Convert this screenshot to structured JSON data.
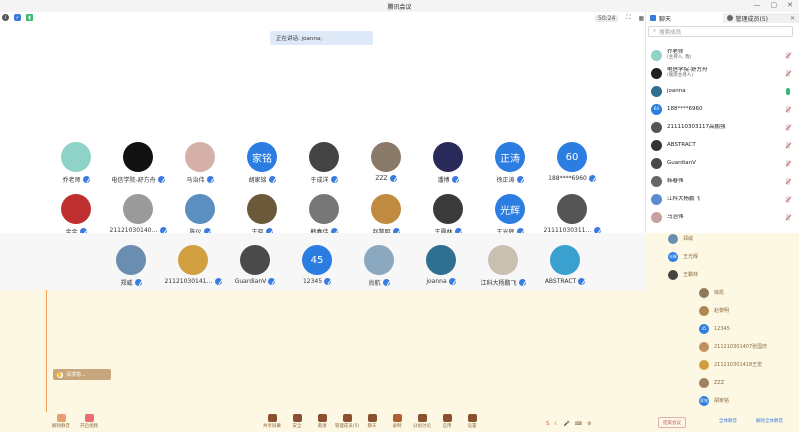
{
  "window": {
    "title": "腾讯会议",
    "controls": [
      "—",
      "▢",
      "✕"
    ]
  },
  "topbar": {
    "timer": "50:24",
    "speaking_label": "正在讲话: joanna;"
  },
  "panel": {
    "tabs": [
      {
        "label": "聊天",
        "icon": "chat-icon"
      },
      {
        "label": "管理成员(5)",
        "icon": "members-icon"
      }
    ],
    "search_placeholder": "搜索成员",
    "members": [
      {
        "name": "乔老师",
        "sub": "(主持人, 我)",
        "color": "#8fd3c8",
        "mic": "muted"
      },
      {
        "name": "电信学院-舒方舟",
        "sub": "(联席主持人)",
        "color": "#222222",
        "mic": "muted"
      },
      {
        "name": "joanna",
        "sub": "",
        "color": "#2f6f8f",
        "mic": "on"
      },
      {
        "name": "188****6960",
        "sub": "",
        "color": "#2b7de1",
        "avatar_text": "60",
        "mic": "muted"
      },
      {
        "name": "211110303117高鹏强",
        "sub": "",
        "color": "#555555",
        "mic": "muted"
      },
      {
        "name": "ABSTRACT",
        "sub": "",
        "color": "#333333",
        "mic": "muted"
      },
      {
        "name": "GuardianV",
        "sub": "",
        "color": "#4a4a4a",
        "mic": "muted"
      },
      {
        "name": "韩春伟",
        "sub": "",
        "color": "#666666",
        "mic": "muted"
      },
      {
        "name": "江科大杨鹏飞",
        "sub": "",
        "color": "#5a8bd0",
        "mic": "muted"
      },
      {
        "name": "马治伟",
        "sub": "",
        "color": "#c8a0a0",
        "mic": "muted"
      }
    ],
    "members_lower": [
      {
        "name": "郑威",
        "color": "#6a8db0"
      },
      {
        "name": "王光辉",
        "color": "#2b7de1",
        "avatar_text": "光辉"
      },
      {
        "name": "王霸林",
        "color": "#444444"
      },
      {
        "name": "徐凯",
        "color": "#8d7a5a"
      },
      {
        "name": "赵黎明",
        "color": "#b08850"
      },
      {
        "name": "12345",
        "color": "#2b7de1",
        "avatar_text": "45"
      },
      {
        "name": "211210301407张国庆",
        "color": "#c09060"
      },
      {
        "name": "211210301418王宏",
        "color": "#d0a040"
      },
      {
        "name": "ZZZ",
        "color": "#a08060"
      },
      {
        "name": "胡家铭",
        "color": "#2b7de1",
        "avatar_text": "家铭"
      }
    ],
    "footer_left": "全体静音",
    "footer_right": "解除全体静音"
  },
  "grid": {
    "row1": [
      {
        "name": "乔老师",
        "color": "#8fd3c8"
      },
      {
        "name": "电信学院-舒方舟",
        "color": "#111111"
      },
      {
        "name": "马治伟",
        "color": "#d4b0a8"
      },
      {
        "name": "胡家铭",
        "color": "#2b7de1",
        "avatar_text": "家铭"
      },
      {
        "name": "于成洋",
        "color": "#444444"
      },
      {
        "name": "ZZZ",
        "color": "#8a7a6a"
      },
      {
        "name": "潘博",
        "color": "#2a2a5a"
      },
      {
        "name": "徐正涛",
        "color": "#2b7de1",
        "avatar_text": "正涛"
      },
      {
        "name": "188****6960",
        "color": "#2b7de1",
        "avatar_text": "60"
      }
    ],
    "row2": [
      {
        "name": "金金",
        "color": "#c03030"
      },
      {
        "name": "211210301407…",
        "color": "#9a9a9a"
      },
      {
        "name": "陈仪",
        "color": "#5a8fbf"
      },
      {
        "name": "王晓",
        "color": "#6a5a3a"
      },
      {
        "name": "韩春伟",
        "color": "#777777"
      },
      {
        "name": "赵黎明",
        "color": "#c08a40"
      },
      {
        "name": "王霸林",
        "color": "#3a3a3a"
      },
      {
        "name": "王光辉",
        "color": "#2b7de1",
        "avatar_text": "光辉"
      },
      {
        "name": "211110303117…",
        "color": "#555555"
      }
    ],
    "row3": [
      {
        "name": "郑威",
        "color": "#6a8db0"
      },
      {
        "name": "211210301418…",
        "color": "#d0a040"
      },
      {
        "name": "GuardianV",
        "color": "#4a4a4a"
      },
      {
        "name": "12345",
        "color": "#2b7de1",
        "avatar_text": "45"
      },
      {
        "name": "尚航",
        "color": "#8aa8c0"
      },
      {
        "name": "joanna",
        "color": "#2f6f8f"
      },
      {
        "name": "江科大杨鹏飞",
        "color": "#c8c0b0"
      },
      {
        "name": "ABSTRACT",
        "color": "#3aa0d0"
      }
    ]
  },
  "overlay": {
    "chip_label": "请求协..."
  },
  "toolbar": {
    "left": [
      {
        "label": "解除静音",
        "color": "#e8a070"
      },
      {
        "label": "开启视频",
        "color": "#e87070"
      }
    ],
    "center": [
      {
        "label": "共享屏幕",
        "color": "#8a5030"
      },
      {
        "label": "安全",
        "color": "#8a5030"
      },
      {
        "label": "邀请",
        "color": "#8a5030"
      },
      {
        "label": "管理成员(5)",
        "color": "#8a5030"
      },
      {
        "label": "聊天",
        "color": "#8a5030"
      },
      {
        "label": "录制",
        "color": "#b06030"
      },
      {
        "label": "分组讨论",
        "color": "#8a5030"
      },
      {
        "label": "应用",
        "color": "#8a5030"
      },
      {
        "label": "设置",
        "color": "#8a5030"
      }
    ],
    "end_label": "结束会议"
  }
}
